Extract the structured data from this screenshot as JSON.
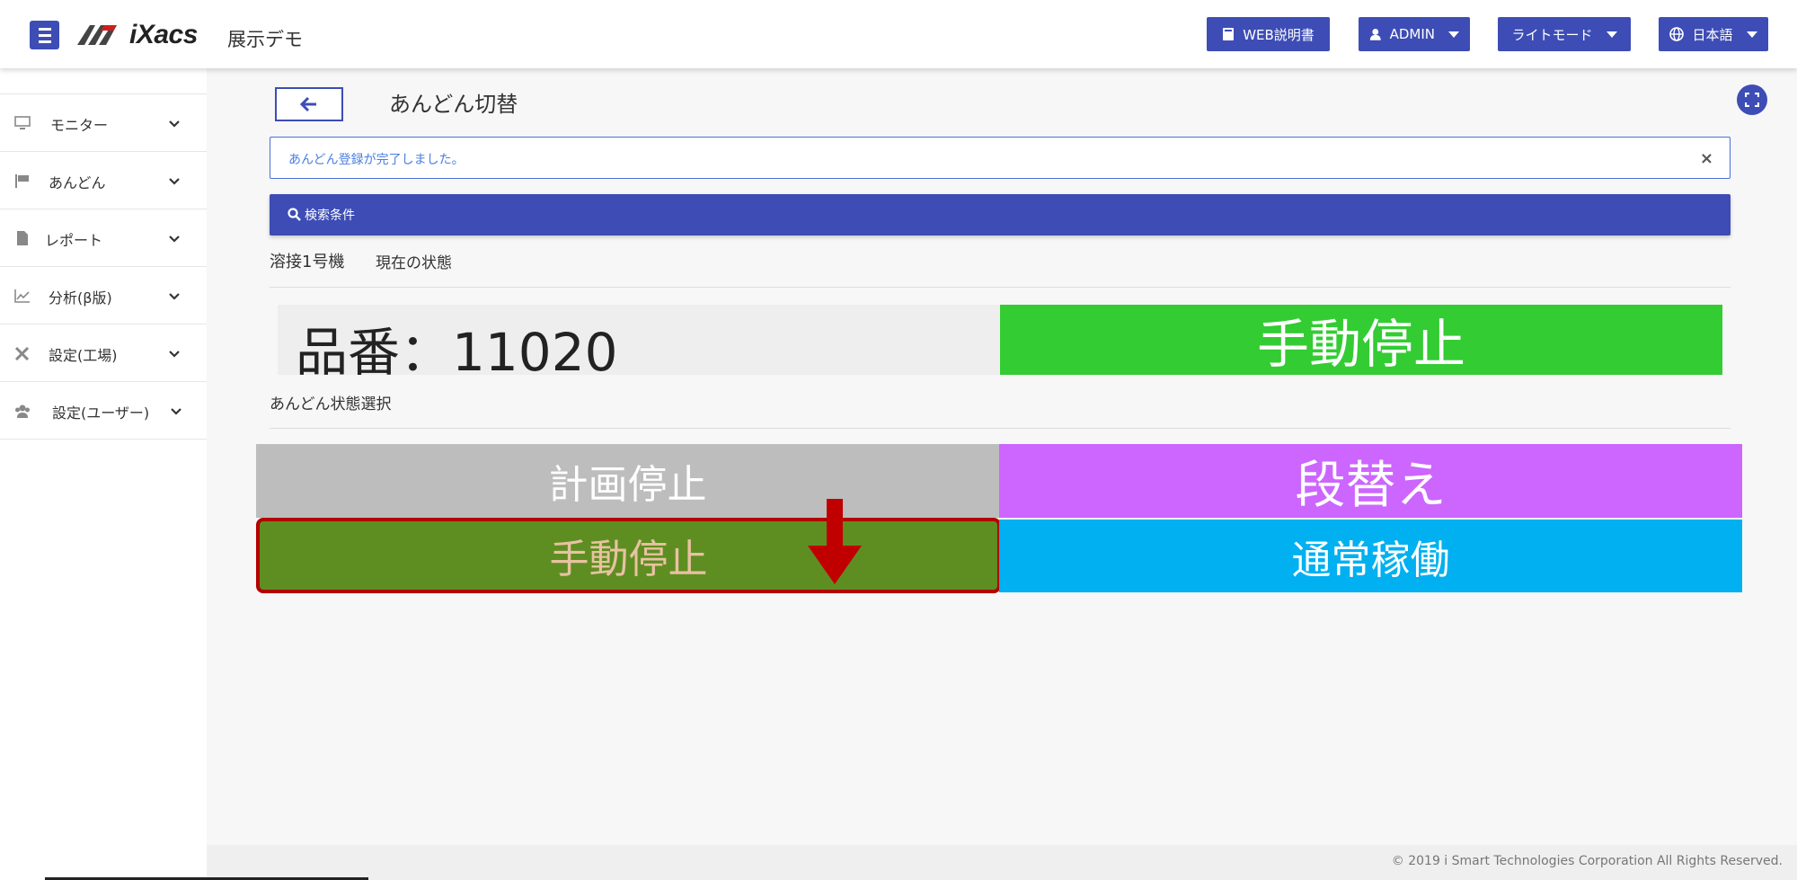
{
  "header": {
    "site_name": "展示デモ",
    "logo_text": "iXacs",
    "buttons": {
      "manual": "WEB説明書",
      "admin": "ADMIN",
      "theme": "ライトモード",
      "language": "日本語"
    }
  },
  "sidebar": {
    "items": [
      {
        "label": "モニター",
        "icon": "monitor-icon"
      },
      {
        "label": "あんどん",
        "icon": "flag-icon"
      },
      {
        "label": "レポート",
        "icon": "document-icon"
      },
      {
        "label": "分析(β版)",
        "icon": "chart-line-icon"
      },
      {
        "label": "設定(工場)",
        "icon": "tools-icon"
      },
      {
        "label": "設定(ユーザー)",
        "icon": "users-icon"
      }
    ]
  },
  "main": {
    "title": "あんどん切替",
    "alert": "あんどん登録が完了しました。",
    "alert_close": "×",
    "search_label": "検索条件",
    "machine": "溶接1号機",
    "current_status_label": "現在の状態",
    "part_number": "品番：11020",
    "current_state": "手動停止",
    "andon_select_label": "あんどん状態選択",
    "states": {
      "plan_stop": "計画停止",
      "setup": "段替え",
      "manual_stop": "手動停止",
      "normal": "通常稼働"
    }
  },
  "colors": {
    "accent": "#3d4db5",
    "current_state_bg": "#33cc33",
    "plan_stop_bg": "#bdbdbd",
    "setup_bg": "#cc66ff",
    "manual_stop_bg": "#5e8e22",
    "normal_bg": "#00b0f0",
    "highlight_border": "#b30000"
  },
  "footer": {
    "copyright": "© 2019 i Smart Technologies Corporation All Rights Reserved."
  }
}
